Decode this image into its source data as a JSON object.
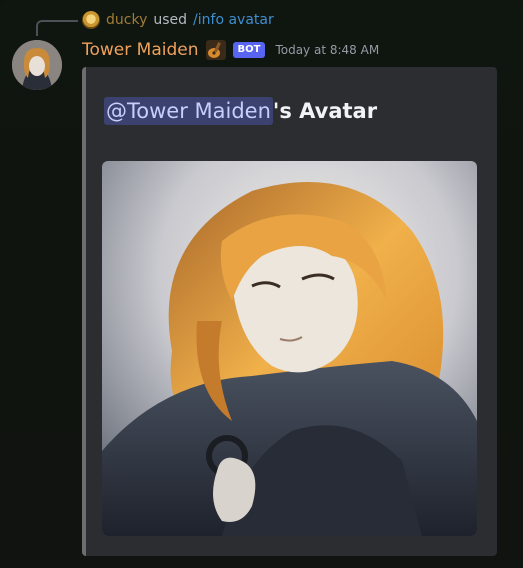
{
  "reply": {
    "user": "ducky",
    "used": "used",
    "command": "/info avatar"
  },
  "message": {
    "author": "Tower Maiden",
    "bot_tag": "BOT",
    "timestamp": "Today at 8:48 AM"
  },
  "embed": {
    "mention": "@Tower Maiden",
    "title_suffix": "'s Avatar",
    "accent_color": "#6d6d70"
  },
  "colors": {
    "author": "#f0a15c",
    "bot_tag": "#5865f2",
    "command": "#3e8ed0",
    "embed_bg": "#2b2d31"
  },
  "icons": {
    "author_badge": "guitar-emoji-icon",
    "reply_avatar": "ducky-avatar-icon"
  }
}
